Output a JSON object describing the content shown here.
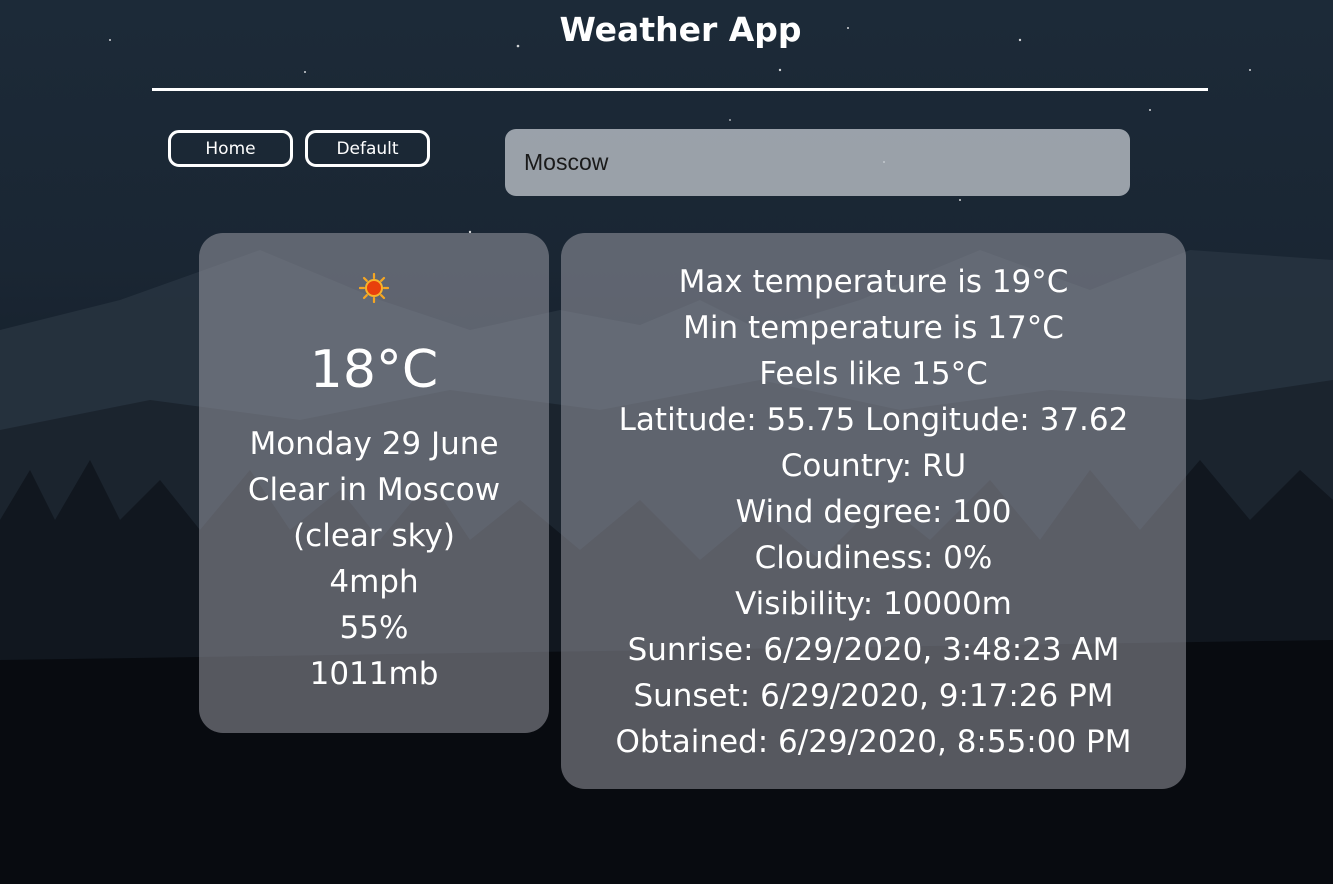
{
  "app": {
    "title": "Weather App"
  },
  "nav": {
    "home_label": "Home",
    "default_label": "Default"
  },
  "search": {
    "value": "Moscow"
  },
  "current": {
    "icon": "sun-icon",
    "temperature": "18°C",
    "date": "Monday 29 June",
    "summary": "Clear in Moscow",
    "description": "(clear sky)",
    "wind": "4mph",
    "humidity": "55%",
    "pressure": "1011mb"
  },
  "details": [
    "Max temperature is 19°C",
    "Min temperature is 17°C",
    "Feels like 15°C",
    "Latitude: 55.75 Longitude: 37.62",
    "Country: RU",
    "Wind degree: 100",
    "Cloudiness: 0%",
    "Visibility: 10000m",
    "Sunrise: 6/29/2020, 3:48:23 AM",
    "Sunset: 6/29/2020, 9:17:26 PM",
    "Obtained: 6/29/2020, 8:55:00 PM"
  ],
  "colors": {
    "card": "#a0a0a8",
    "search": "#bec4ca",
    "text": "#ffffff"
  }
}
